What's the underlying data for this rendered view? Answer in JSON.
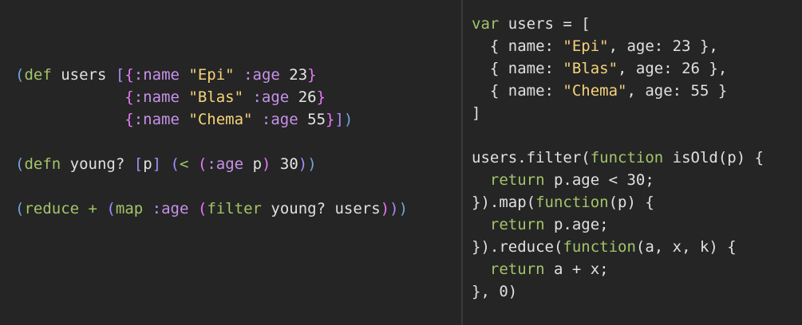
{
  "left_pane": {
    "language": "clojure",
    "lines": [
      [
        {
          "t": "(",
          "c": "paren"
        },
        {
          "t": "def",
          "c": "kw"
        },
        {
          "t": " users ",
          "c": "plain"
        },
        {
          "t": "[",
          "c": "paren2"
        },
        {
          "t": "{",
          "c": "paren3"
        },
        {
          "t": ":name",
          "c": "kwcl"
        },
        {
          "t": " ",
          "c": "plain"
        },
        {
          "t": "\"Epi\"",
          "c": "str"
        },
        {
          "t": " ",
          "c": "plain"
        },
        {
          "t": ":age",
          "c": "kwcl"
        },
        {
          "t": " 23",
          "c": "num"
        },
        {
          "t": "}",
          "c": "paren3"
        }
      ],
      [
        {
          "t": "            ",
          "c": "plain"
        },
        {
          "t": "{",
          "c": "paren3"
        },
        {
          "t": ":name",
          "c": "kwcl"
        },
        {
          "t": " ",
          "c": "plain"
        },
        {
          "t": "\"Blas\"",
          "c": "str"
        },
        {
          "t": " ",
          "c": "plain"
        },
        {
          "t": ":age",
          "c": "kwcl"
        },
        {
          "t": " 26",
          "c": "num"
        },
        {
          "t": "}",
          "c": "paren3"
        }
      ],
      [
        {
          "t": "            ",
          "c": "plain"
        },
        {
          "t": "{",
          "c": "paren3"
        },
        {
          "t": ":name",
          "c": "kwcl"
        },
        {
          "t": " ",
          "c": "plain"
        },
        {
          "t": "\"Chema\"",
          "c": "str"
        },
        {
          "t": " ",
          "c": "plain"
        },
        {
          "t": ":age",
          "c": "kwcl"
        },
        {
          "t": " 55",
          "c": "num"
        },
        {
          "t": "}",
          "c": "paren3"
        },
        {
          "t": "]",
          "c": "paren2"
        },
        {
          "t": ")",
          "c": "paren"
        }
      ],
      [],
      [
        {
          "t": "(",
          "c": "paren"
        },
        {
          "t": "defn",
          "c": "kw"
        },
        {
          "t": " young? ",
          "c": "plain"
        },
        {
          "t": "[",
          "c": "paren2"
        },
        {
          "t": "p",
          "c": "plain"
        },
        {
          "t": "]",
          "c": "paren2"
        },
        {
          "t": " ",
          "c": "plain"
        },
        {
          "t": "(",
          "c": "paren2"
        },
        {
          "t": "<",
          "c": "kw"
        },
        {
          "t": " ",
          "c": "plain"
        },
        {
          "t": "(",
          "c": "paren3"
        },
        {
          "t": ":age",
          "c": "kwcl"
        },
        {
          "t": " p",
          "c": "plain"
        },
        {
          "t": ")",
          "c": "paren3"
        },
        {
          "t": " 30",
          "c": "num"
        },
        {
          "t": ")",
          "c": "paren2"
        },
        {
          "t": ")",
          "c": "paren"
        }
      ],
      [],
      [
        {
          "t": "(",
          "c": "paren"
        },
        {
          "t": "reduce",
          "c": "kw"
        },
        {
          "t": " + ",
          "c": "kw"
        },
        {
          "t": "(",
          "c": "paren2"
        },
        {
          "t": "map",
          "c": "kw"
        },
        {
          "t": " ",
          "c": "plain"
        },
        {
          "t": ":age",
          "c": "kwcl"
        },
        {
          "t": " ",
          "c": "plain"
        },
        {
          "t": "(",
          "c": "paren3"
        },
        {
          "t": "filter",
          "c": "kw"
        },
        {
          "t": " young? users",
          "c": "plain"
        },
        {
          "t": ")",
          "c": "paren3"
        },
        {
          "t": ")",
          "c": "paren2"
        },
        {
          "t": ")",
          "c": "paren"
        }
      ]
    ]
  },
  "right_pane": {
    "language": "javascript",
    "lines": [
      [
        {
          "t": "var",
          "c": "kw"
        },
        {
          "t": " users = [",
          "c": "plain"
        }
      ],
      [
        {
          "t": "  { name: ",
          "c": "plain"
        },
        {
          "t": "\"Epi\"",
          "c": "str"
        },
        {
          "t": ", age: 23 },",
          "c": "plain"
        }
      ],
      [
        {
          "t": "  { name: ",
          "c": "plain"
        },
        {
          "t": "\"Blas\"",
          "c": "str"
        },
        {
          "t": ", age: 26 },",
          "c": "plain"
        }
      ],
      [
        {
          "t": "  { name: ",
          "c": "plain"
        },
        {
          "t": "\"Chema\"",
          "c": "str"
        },
        {
          "t": ", age: 55 }",
          "c": "plain"
        }
      ],
      [
        {
          "t": "]",
          "c": "plain"
        }
      ],
      [],
      [
        {
          "t": "users.filter(",
          "c": "plain"
        },
        {
          "t": "function",
          "c": "kw"
        },
        {
          "t": " isOld(p) {",
          "c": "plain"
        }
      ],
      [
        {
          "t": "  ",
          "c": "plain"
        },
        {
          "t": "return",
          "c": "kw"
        },
        {
          "t": " p.age < 30;",
          "c": "plain"
        }
      ],
      [
        {
          "t": "}).map(",
          "c": "plain"
        },
        {
          "t": "function",
          "c": "kw"
        },
        {
          "t": "(p) {",
          "c": "plain"
        }
      ],
      [
        {
          "t": "  ",
          "c": "plain"
        },
        {
          "t": "return",
          "c": "kw"
        },
        {
          "t": " p.age;",
          "c": "plain"
        }
      ],
      [
        {
          "t": "}).reduce(",
          "c": "plain"
        },
        {
          "t": "function",
          "c": "kw"
        },
        {
          "t": "(a, x, k) {",
          "c": "plain"
        }
      ],
      [
        {
          "t": "  ",
          "c": "plain"
        },
        {
          "t": "return",
          "c": "kw"
        },
        {
          "t": " a + x;",
          "c": "plain"
        }
      ],
      [
        {
          "t": "}, 0)",
          "c": "plain"
        }
      ]
    ]
  },
  "colors": {
    "background": "#252525",
    "divider": "#3b3b3b",
    "paren": "#6fa8dc",
    "paren2": "#a78bfa",
    "paren3": "#e879f9",
    "kw": "#a3c46a",
    "kwcl": "#c792ea",
    "str": "#f4d37a",
    "num": "#e6e6e6",
    "plain": "#e0e0e0"
  }
}
